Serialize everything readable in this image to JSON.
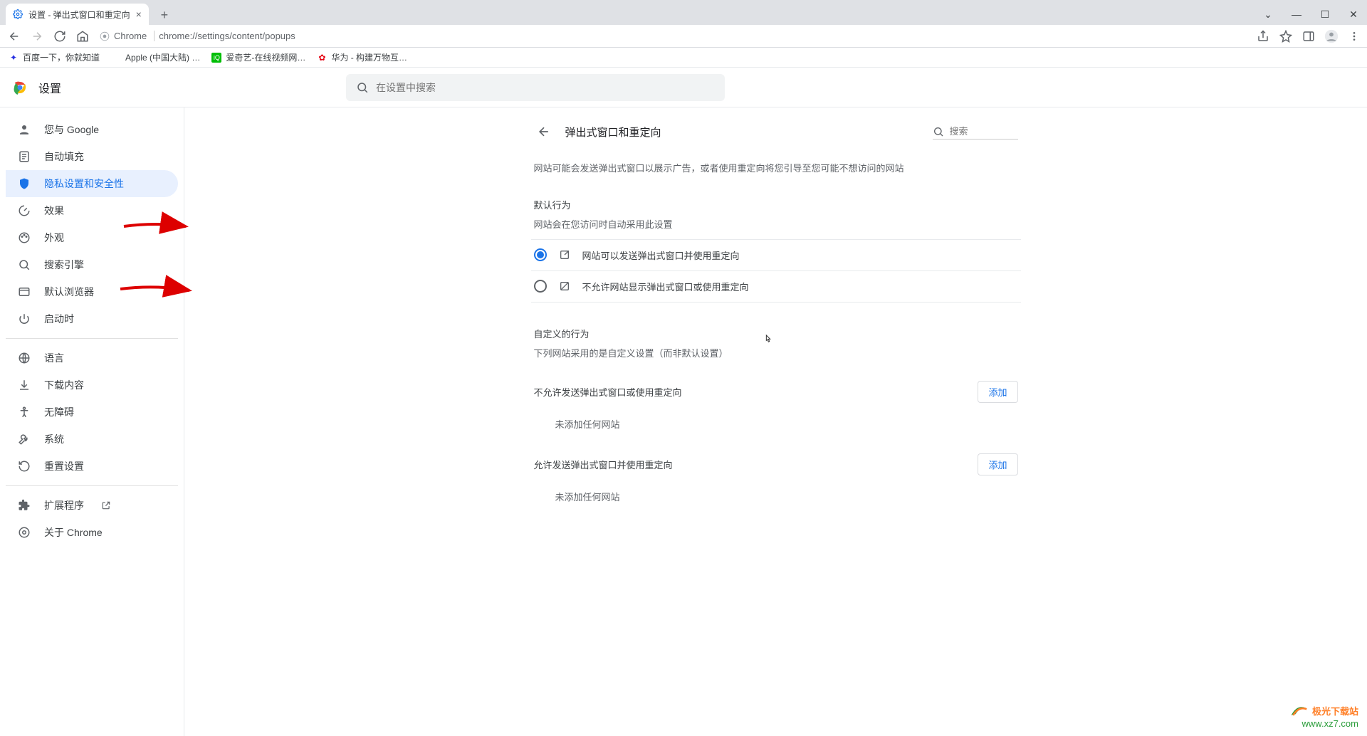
{
  "tab": {
    "title": "设置 - 弹出式窗口和重定向"
  },
  "url": {
    "scheme_label": "Chrome",
    "path": "chrome://settings/content/popups"
  },
  "bookmarks": [
    {
      "label": "百度一下，你就知道"
    },
    {
      "label": "Apple (中国大陆) …"
    },
    {
      "label": "爱奇艺-在线视频网…"
    },
    {
      "label": "华为 - 构建万物互…"
    }
  ],
  "header": {
    "title": "设置",
    "search_placeholder": "在设置中搜索"
  },
  "sidebar": {
    "items": [
      {
        "label": "您与 Google"
      },
      {
        "label": "自动填充"
      },
      {
        "label": "隐私设置和安全性"
      },
      {
        "label": "效果"
      },
      {
        "label": "外观"
      },
      {
        "label": "搜索引擎"
      },
      {
        "label": "默认浏览器"
      },
      {
        "label": "启动时"
      }
    ],
    "items2": [
      {
        "label": "语言"
      },
      {
        "label": "下载内容"
      },
      {
        "label": "无障碍"
      },
      {
        "label": "系统"
      },
      {
        "label": "重置设置"
      }
    ],
    "items3": [
      {
        "label": "扩展程序"
      },
      {
        "label": "关于 Chrome"
      }
    ]
  },
  "content": {
    "title": "弹出式窗口和重定向",
    "search_placeholder": "搜索",
    "description": "网站可能会发送弹出式窗口以展示广告，或者使用重定向将您引导至您可能不想访问的网站",
    "default_behavior_title": "默认行为",
    "default_behavior_sub": "网站会在您访问时自动采用此设置",
    "option_allow": "网站可以发送弹出式窗口并使用重定向",
    "option_block": "不允许网站显示弹出式窗口或使用重定向",
    "custom_title": "自定义的行为",
    "custom_sub": "下列网站采用的是自定义设置（而非默认设置）",
    "block_list_header": "不允许发送弹出式窗口或使用重定向",
    "allow_list_header": "允许发送弹出式窗口并使用重定向",
    "add_button": "添加",
    "empty_text": "未添加任何网站"
  },
  "watermark": {
    "brand": "极光下载站",
    "url": "www.xz7.com"
  }
}
